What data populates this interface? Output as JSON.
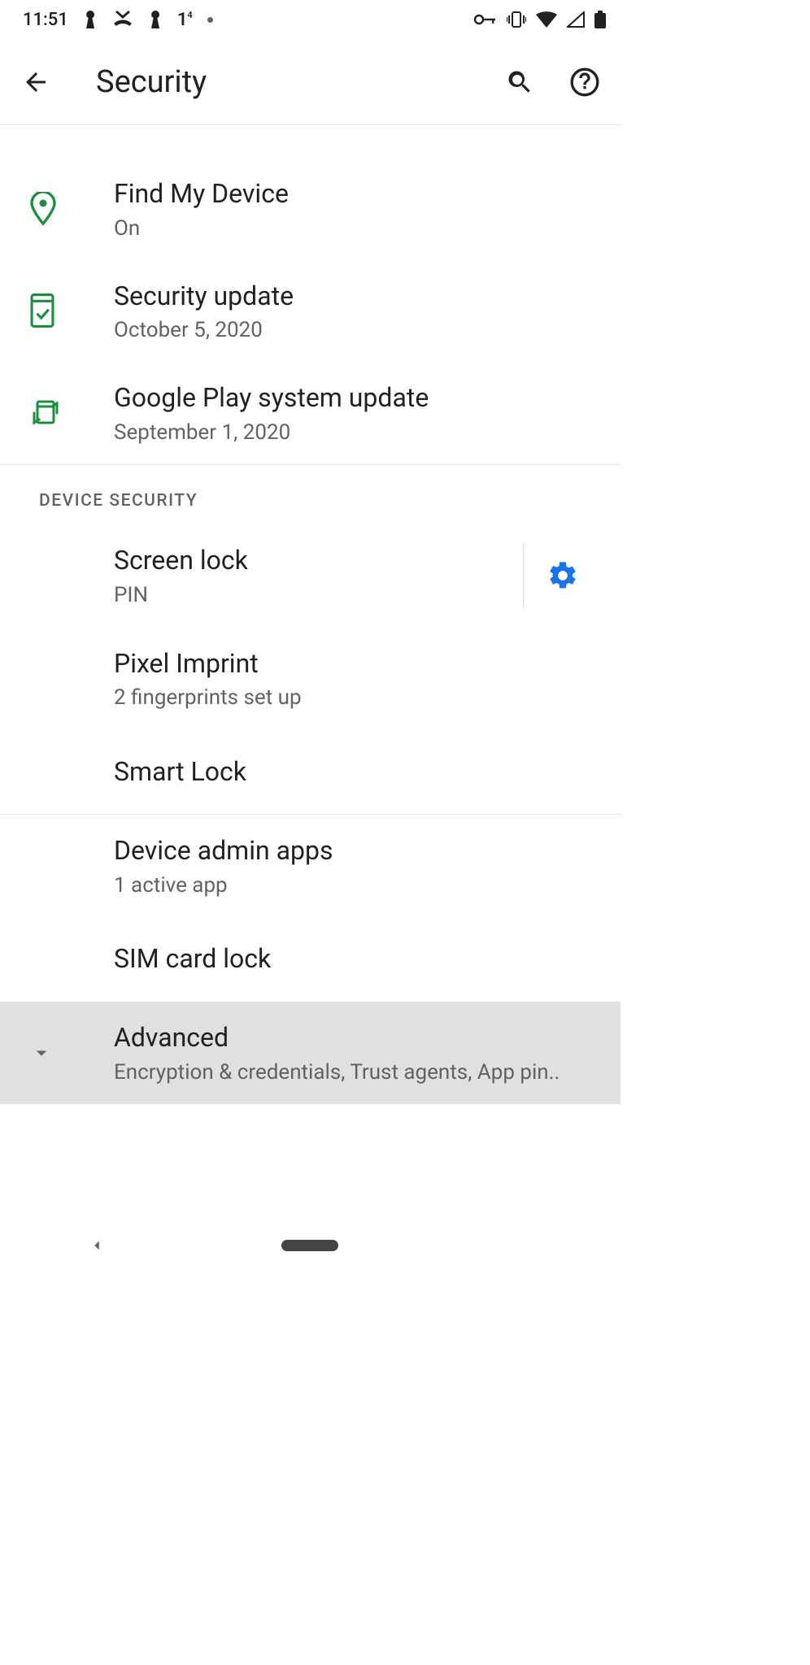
{
  "status": {
    "time": "11:51"
  },
  "header": {
    "title": "Security"
  },
  "items": {
    "findMyDevice": {
      "title": "Find My Device",
      "sub": "On"
    },
    "securityUpdate": {
      "title": "Security update",
      "sub": "October 5, 2020"
    },
    "playUpdate": {
      "title": "Google Play system update",
      "sub": "September 1, 2020"
    },
    "screenLock": {
      "title": "Screen lock",
      "sub": "PIN"
    },
    "pixelImprint": {
      "title": "Pixel Imprint",
      "sub": "2 fingerprints set up"
    },
    "smartLock": {
      "title": "Smart Lock"
    },
    "deviceAdmin": {
      "title": "Device admin apps",
      "sub": "1 active app"
    },
    "simLock": {
      "title": "SIM card lock"
    },
    "advanced": {
      "title": "Advanced",
      "sub": "Encryption & credentials, Trust agents, App pin.."
    }
  },
  "sections": {
    "deviceSecurity": "DEVICE SECURITY"
  }
}
